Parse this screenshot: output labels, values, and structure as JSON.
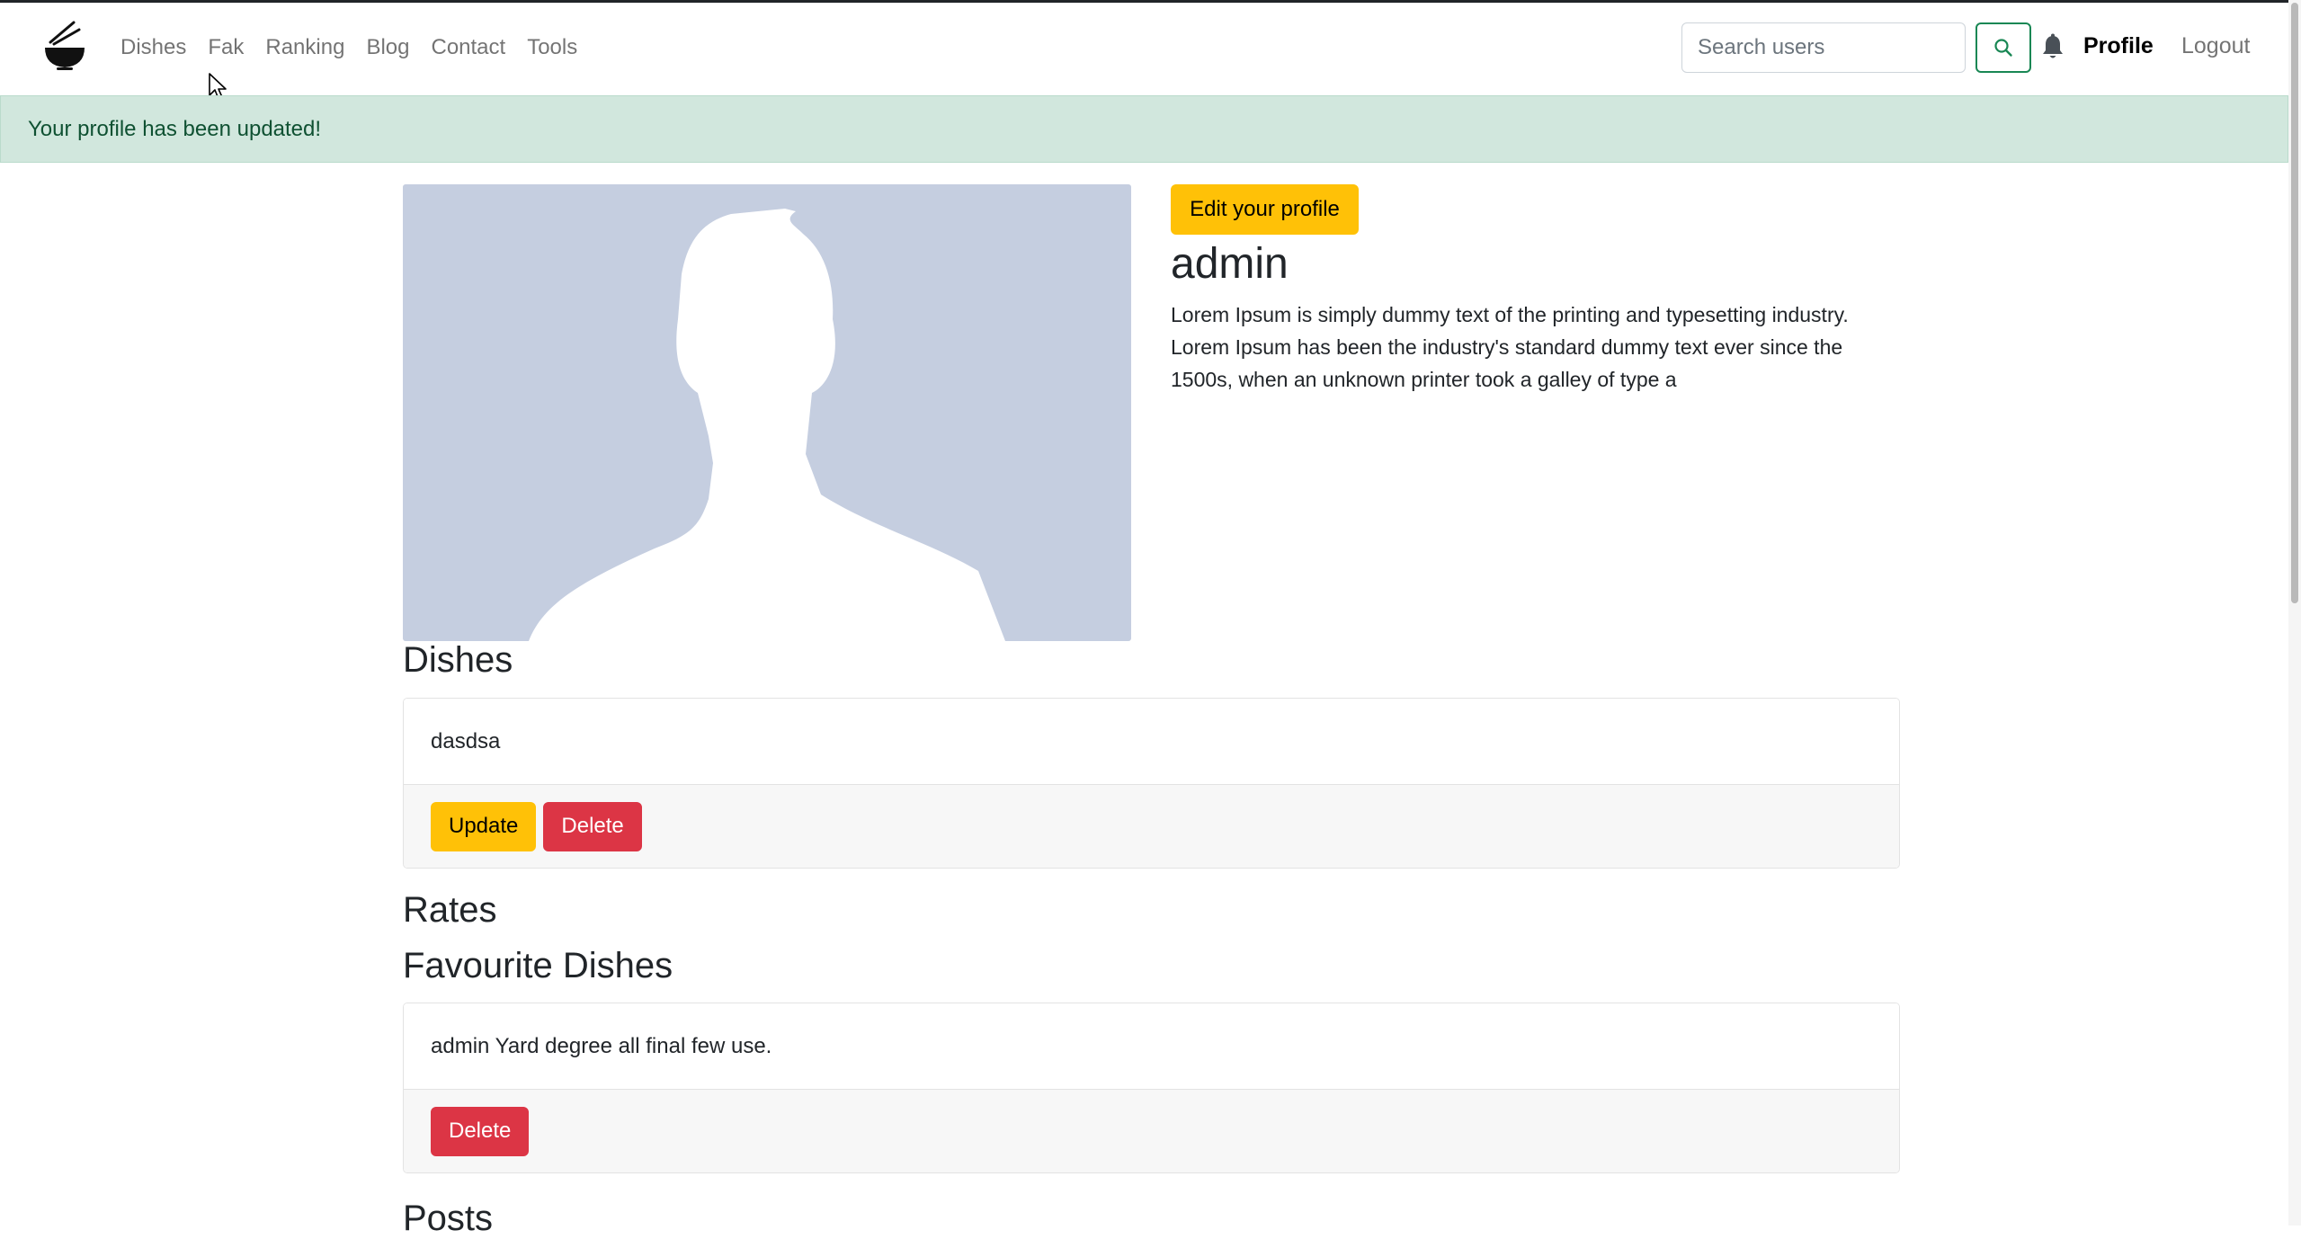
{
  "nav": {
    "links": [
      "Dishes",
      "Fak",
      "Ranking",
      "Blog",
      "Contact",
      "Tools"
    ],
    "search_placeholder": "Search users",
    "profile": "Profile",
    "logout": "Logout"
  },
  "alert": {
    "message": "Your profile has been updated!"
  },
  "profile": {
    "edit_label": "Edit your profile",
    "username": "admin",
    "bio": "Lorem Ipsum is simply dummy text of the printing and typesetting industry. Lorem Ipsum has been the industry's standard dummy text ever since the 1500s, when an unknown printer took a galley of type a"
  },
  "dishes": {
    "title": "Dishes",
    "items": [
      {
        "name": "dasdsa",
        "update_label": "Update",
        "delete_label": "Delete"
      }
    ]
  },
  "rates": {
    "title": "Rates"
  },
  "favourites": {
    "title": "Favourite Dishes",
    "items": [
      {
        "text": "admin Yard degree all final few use.",
        "delete_label": "Delete"
      }
    ]
  },
  "posts": {
    "title": "Posts"
  },
  "colors": {
    "warning": "#ffc107",
    "danger": "#dc3545",
    "success": "#198754",
    "alert_bg": "#d1e7dd",
    "alert_text": "#0f5132",
    "avatar_bg": "#c5cee0"
  }
}
